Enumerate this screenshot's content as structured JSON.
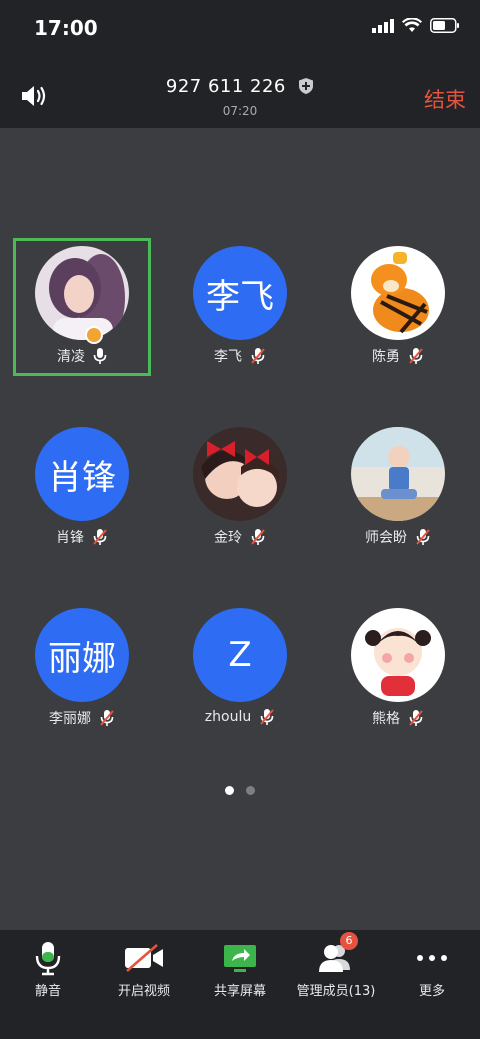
{
  "status": {
    "time": "17:00"
  },
  "header": {
    "meeting_id": "927 611 226",
    "timer": "07:20",
    "end_label": "结束"
  },
  "participants": [
    {
      "name": "清凌",
      "avatar_text": "",
      "mic": "on",
      "host": true
    },
    {
      "name": "李飞",
      "avatar_text": "李飞",
      "mic": "muted"
    },
    {
      "name": "陈勇",
      "avatar_text": "",
      "mic": "muted"
    },
    {
      "name": "肖锋",
      "avatar_text": "肖锋",
      "mic": "muted"
    },
    {
      "name": "金玲",
      "avatar_text": "",
      "mic": "muted"
    },
    {
      "name": "师会盼",
      "avatar_text": "",
      "mic": "muted"
    },
    {
      "name": "李丽娜",
      "avatar_text": "丽娜",
      "mic": "muted"
    },
    {
      "name": "zhoulu",
      "avatar_text": "Z",
      "mic": "muted"
    },
    {
      "name": "熊格",
      "avatar_text": "",
      "mic": "muted"
    }
  ],
  "pager": {
    "pages": 2,
    "current": 1
  },
  "toolbar": {
    "mute_label": "静音",
    "video_label": "开启视频",
    "share_label": "共享屏幕",
    "members_label": "管理成员(13)",
    "members_badge": "6",
    "more_label": "更多"
  },
  "colors": {
    "accent_blue": "#2d6cf3",
    "end_red": "#e5533f",
    "active_green": "#4cba58",
    "share_green": "#3cb54a"
  }
}
